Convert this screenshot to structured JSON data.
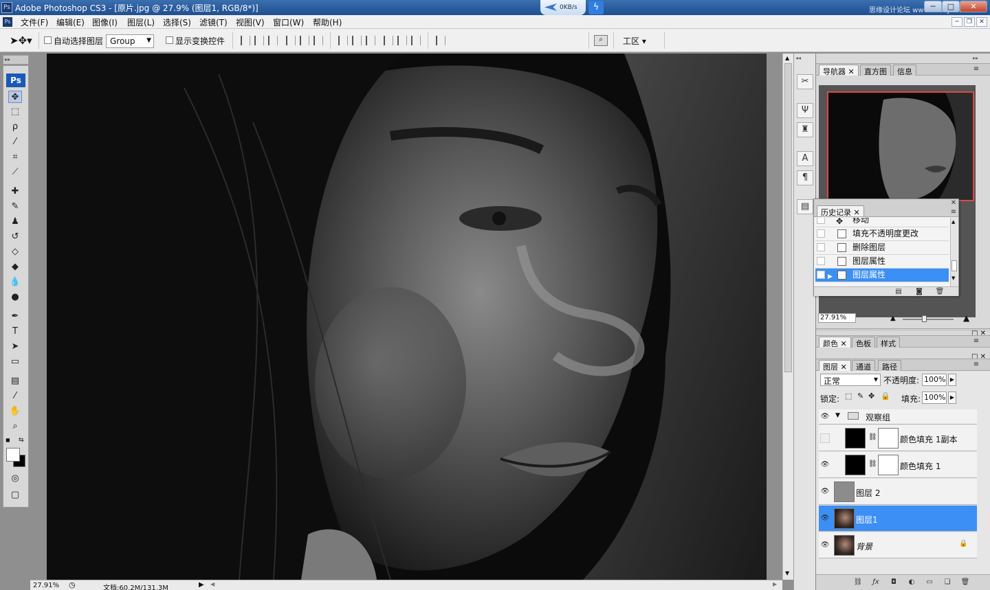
{
  "window": {
    "title": "Adobe Photoshop CS3 - [原片.jpg @ 27.9% (图层1, RGB/8*)]",
    "speed": "0KB/s",
    "watermark": "思缘设计论坛 www.missyuan.com",
    "min": "─",
    "max": "□",
    "close": "✕"
  },
  "menu": [
    "文件(F)",
    "编辑(E)",
    "图像(I)",
    "图层(L)",
    "选择(S)",
    "滤镜(T)",
    "视图(V)",
    "窗口(W)",
    "帮助(H)"
  ],
  "options": {
    "auto_select": "自动选择图层",
    "group_value": "Group",
    "show_transform": "显示变换控件",
    "workspace": "工区"
  },
  "tools": [
    "move-tool",
    "marquee-tool",
    "lasso-tool",
    "magic-wand-tool",
    "crop-tool",
    "slice-tool",
    "healing-tool",
    "brush-tool",
    "stamp-tool",
    "history-brush-tool",
    "eraser-tool",
    "paint-bucket-tool",
    "blur-tool",
    "dodge-tool",
    "pen-tool",
    "type-tool",
    "path-select-tool",
    "shape-tool",
    "notes-tool",
    "eyedropper-tool",
    "hand-tool",
    "zoom-tool"
  ],
  "status": {
    "zoom": "27.91%",
    "doc": "文档:60.2M/131.3M"
  },
  "navigator": {
    "tabs": [
      "导航器",
      "直方图",
      "信息"
    ],
    "zoom": "27.91%"
  },
  "history": {
    "title": "历史记录",
    "items": [
      "移动",
      "填充不透明度更改",
      "删除图层",
      "图层属性",
      "图层属性"
    ]
  },
  "color_panel": {
    "tabs": [
      "颜色",
      "色板",
      "样式"
    ]
  },
  "layers_panel": {
    "tabs": [
      "图层",
      "通道",
      "路径"
    ],
    "blend_mode": "正常",
    "opacity_label": "不透明度:",
    "opacity": "100%",
    "lock_label": "锁定:",
    "fill_label": "填充:",
    "fill": "100%",
    "group_name": "观察组",
    "layers": [
      "颜色填充 1副本",
      "颜色填充 1",
      "图层 2",
      "图层1",
      "背景"
    ]
  }
}
